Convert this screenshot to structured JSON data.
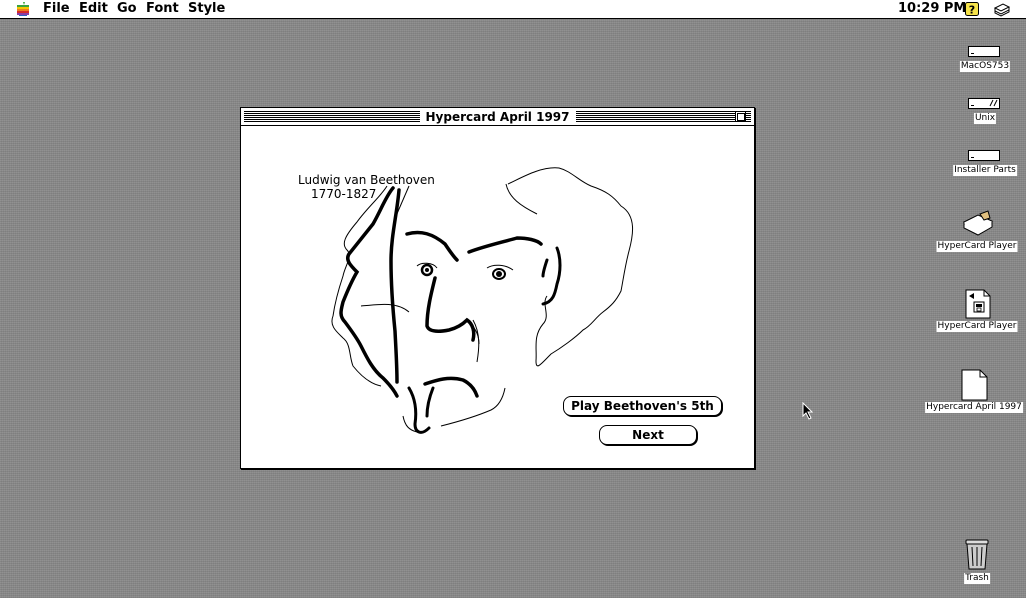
{
  "menubar": {
    "items": [
      "File",
      "Edit",
      "Go",
      "Font",
      "Style"
    ],
    "clock": "10:29 PM",
    "apple_icon": "apple-icon",
    "help_icon": "help-icon",
    "app_icon": "hypercard-app-icon"
  },
  "window": {
    "title": "Hypercard April 1997",
    "card": {
      "portrait_name": "Ludwig van Beethoven",
      "portrait_dates": "1770-1827",
      "play_button": "Play Beethoven's 5th",
      "next_button": "Next"
    }
  },
  "desktop": {
    "icons": [
      {
        "label": "MacOS753",
        "icon": "hard-disk-icon"
      },
      {
        "label": "Unix",
        "icon": "hard-disk-icon"
      },
      {
        "label": "Installer Parts",
        "icon": "hard-disk-icon"
      },
      {
        "label": "HyperCard Player",
        "icon": "hypercard-stack-icon"
      },
      {
        "label": "HyperCard Player",
        "icon": "hypercard-application-icon"
      },
      {
        "label": "Hypercard April 1997",
        "icon": "document-icon"
      },
      {
        "label": "Trash",
        "icon": "trash-icon"
      }
    ]
  }
}
